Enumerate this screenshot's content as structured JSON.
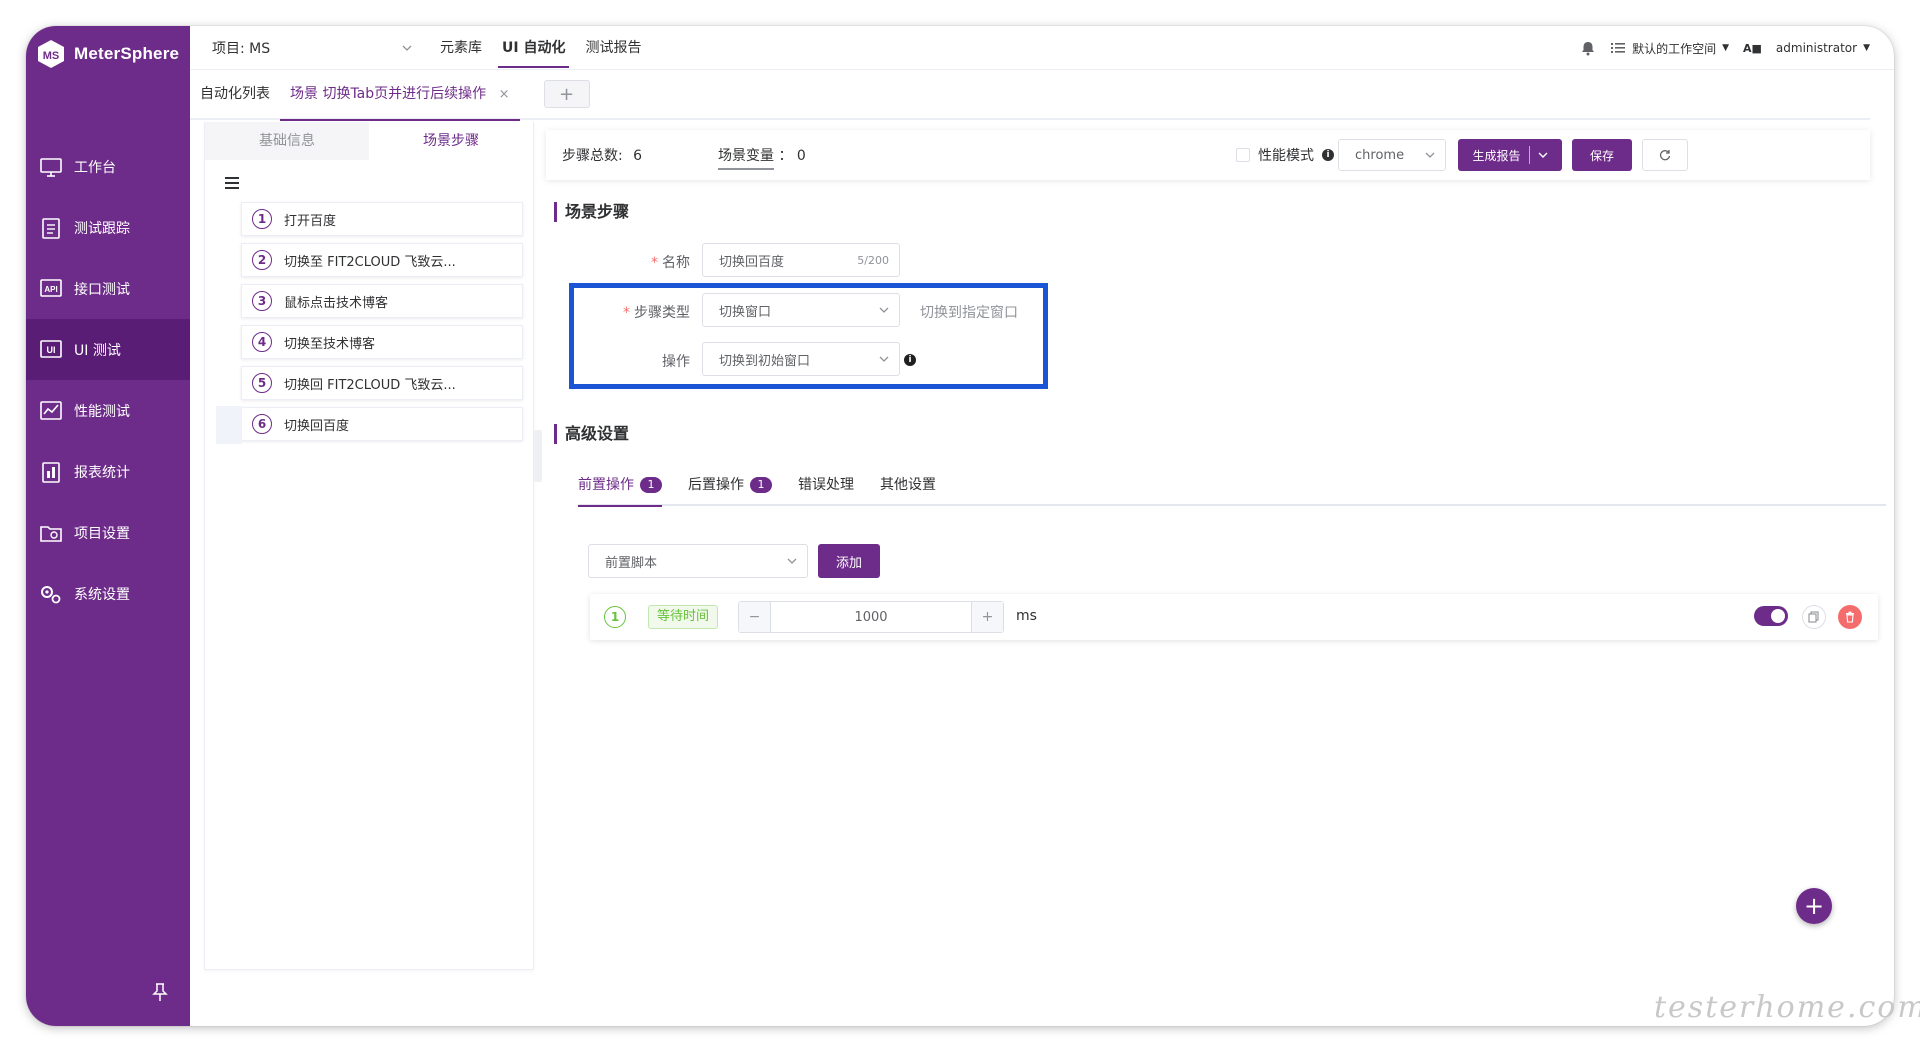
{
  "app": {
    "name": "MeterSphere"
  },
  "sidebar": {
    "items": [
      {
        "label": "工作台",
        "icon": "monitor-icon"
      },
      {
        "label": "测试跟踪",
        "icon": "clipboard-icon"
      },
      {
        "label": "接口测试",
        "icon": "api-icon"
      },
      {
        "label": "UI 测试",
        "icon": "ui-icon"
      },
      {
        "label": "性能测试",
        "icon": "chart-icon"
      },
      {
        "label": "报表统计",
        "icon": "report-icon"
      },
      {
        "label": "项目设置",
        "icon": "folder-gear-icon"
      },
      {
        "label": "系统设置",
        "icon": "gears-icon"
      }
    ],
    "active_index": 3
  },
  "topbar": {
    "project": "项目: MS",
    "menu": [
      "元素库",
      "UI 自动化",
      "测试报告"
    ],
    "active_menu": 1,
    "workspace": "默认的工作空间",
    "user": "administrator",
    "lang_icon": "A■"
  },
  "tabs": {
    "items": [
      "自动化列表",
      "场景 切换Tab页并进行后续操作"
    ],
    "close": "×",
    "add": "+"
  },
  "left_panel": {
    "tabs": [
      "基础信息",
      "场景步骤"
    ],
    "steps": [
      {
        "num": "1",
        "label": "打开百度"
      },
      {
        "num": "2",
        "label": "切换至 FIT2CLOUD 飞致云..."
      },
      {
        "num": "3",
        "label": "鼠标点击技术博客"
      },
      {
        "num": "4",
        "label": "切换至技术博客"
      },
      {
        "num": "5",
        "label": "切换回 FIT2CLOUD 飞致云..."
      },
      {
        "num": "6",
        "label": "切换回百度"
      }
    ]
  },
  "scene_header": {
    "total_label": "步骤总数:",
    "total_value": "6",
    "var_label": "场景变量",
    "var_value": "：  0",
    "perf_label": "性能模式",
    "browser": "chrome",
    "report_button": "生成报告",
    "save_button": "保存"
  },
  "step_form": {
    "section_title": "场景步骤",
    "name_label": "名称",
    "name_value": "切换回百度",
    "name_count": "5/200",
    "type_label": "步骤类型",
    "type_value": "切换窗口",
    "type_hint": "切换到指定窗口",
    "op_label": "操作",
    "op_value": "切换到初始窗口",
    "required_mark": "*"
  },
  "advanced": {
    "section_title": "高级设置",
    "tabs": [
      {
        "label": "前置操作",
        "badge": "1"
      },
      {
        "label": "后置操作",
        "badge": "1"
      },
      {
        "label": "错误处理",
        "badge": ""
      },
      {
        "label": "其他设置",
        "badge": ""
      }
    ],
    "script_select": "前置脚本",
    "add_button": "添加",
    "wait": {
      "num": "1",
      "tag": "等待时间",
      "minus": "−",
      "plus": "+",
      "value": "1000",
      "unit": "ms",
      "enabled": true
    }
  },
  "fab": "+",
  "watermark": "testerhome.com",
  "colors": {
    "brand": "#6e2c8a",
    "highlight": "#1a55d6",
    "danger": "#f56c6c",
    "success": "#67c23a"
  }
}
